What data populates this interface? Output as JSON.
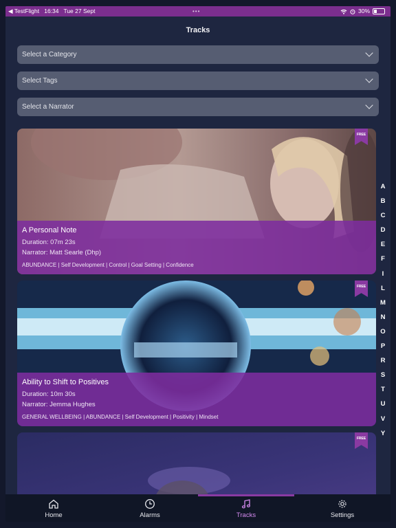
{
  "status_bar": {
    "app": "◀ TestFlight",
    "time": "16:34",
    "date": "Tue 27 Sept",
    "battery": "30%",
    "battery_level": 0.3
  },
  "header": {
    "title": "Tracks"
  },
  "filters": {
    "category": "Select a Category",
    "tags": "Select Tags",
    "narrator": "Select a Narrator"
  },
  "badge_label": "FREE",
  "tracks": [
    {
      "title": "A Personal Note",
      "duration": "Duration: 07m 23s",
      "narrator": "Narrator: Matt Searle (Dhp)",
      "tags": "ABUNDANCE | Self Development | Control | Goal Setting | Confidence",
      "badge": "FREE"
    },
    {
      "title": "Ability to Shift to Positives",
      "duration": "Duration: 10m 30s",
      "narrator": "Narrator: Jemma Hughes",
      "tags": "GENERAL WELLBEING | ABUNDANCE | Self Development | Positivity | Mindset",
      "badge": "FREE"
    },
    {
      "badge": "FREE"
    }
  ],
  "alphabet": [
    "A",
    "B",
    "C",
    "D",
    "E",
    "F",
    "I",
    "L",
    "M",
    "N",
    "O",
    "P",
    "R",
    "S",
    "T",
    "U",
    "V",
    "Y"
  ],
  "tabs": [
    {
      "label": "Home",
      "icon": "home-icon"
    },
    {
      "label": "Alarms",
      "icon": "clock-icon"
    },
    {
      "label": "Tracks",
      "icon": "music-note-icon",
      "active": true
    },
    {
      "label": "Settings",
      "icon": "gear-icon"
    }
  ],
  "colors": {
    "accent": "#7d2c9e",
    "active_tab": "#d58bf0",
    "background": "#1e2640"
  }
}
